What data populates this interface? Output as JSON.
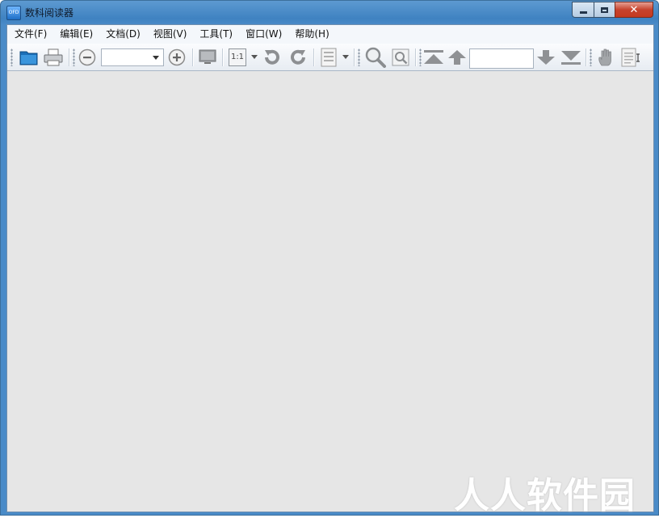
{
  "window": {
    "title": "数科阅读器",
    "icon_text": "OFD",
    "controls": {
      "minimize": "",
      "maximize": "",
      "close": "✕"
    }
  },
  "menu": {
    "items": [
      {
        "label": "文件(F)"
      },
      {
        "label": "编辑(E)"
      },
      {
        "label": "文档(D)"
      },
      {
        "label": "视图(V)"
      },
      {
        "label": "工具(T)"
      },
      {
        "label": "窗口(W)"
      },
      {
        "label": "帮助(H)"
      }
    ]
  },
  "toolbar": {
    "open_icon": "open-folder-icon",
    "print_icon": "printer-icon",
    "zoom_out_icon": "zoom-out-circle-icon",
    "zoom_value": "",
    "zoom_in_icon": "zoom-in-circle-icon",
    "fullscreen_icon": "monitor-icon",
    "actual_size_label": "1:1",
    "rotate_left_icon": "rotate-ccw-icon",
    "rotate_right_icon": "rotate-cw-icon",
    "page_layout_icon": "page-layout-icon",
    "search_icon": "magnifier-icon",
    "zoom_area_icon": "zoom-area-icon",
    "first_page_icon": "first-page-icon",
    "prev_page_icon": "arrow-up-icon",
    "page_number": "",
    "next_page_icon": "arrow-down-icon",
    "last_page_icon": "last-page-icon",
    "hand_tool_icon": "hand-icon",
    "select_text_icon": "select-text-icon"
  },
  "watermark": {
    "text": "人人软件园"
  }
}
